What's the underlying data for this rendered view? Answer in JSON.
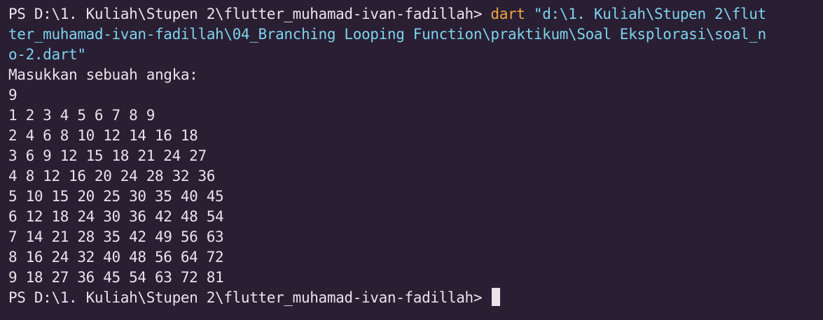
{
  "terminal": {
    "colors": {
      "background": "#2a1e33",
      "foreground": "#e7e4ec",
      "command": "#f0a63e",
      "string": "#7dd3ec",
      "cursor": "#e7e4ec"
    },
    "prompt": "PS D:\\1. Kuliah\\Stupen 2\\flutter_muhamad-ivan-fadillah> ",
    "command": "dart",
    "arg_line1": " \"d:\\1. Kuliah\\Stupen 2\\flut",
    "arg_line2": "ter_muhamad-ivan-fadillah\\04_Branching Looping Function\\praktikum\\Soal Eksplorasi\\soal_n",
    "arg_line3": "o-2.dart\"",
    "input_prompt": "Masukkan sebuah angka:",
    "input_value": "9",
    "output_rows": [
      "1 2 3 4 5 6 7 8 9",
      "2 4 6 8 10 12 14 16 18",
      "3 6 9 12 15 18 21 24 27",
      "4 8 12 16 20 24 28 32 36",
      "5 10 15 20 25 30 35 40 45",
      "6 12 18 24 30 36 42 48 54",
      "7 14 21 28 35 42 49 56 63",
      "8 16 24 32 40 48 56 64 72",
      "9 18 27 36 45 54 63 72 81"
    ],
    "final_prompt": "PS D:\\1. Kuliah\\Stupen 2\\flutter_muhamad-ivan-fadillah> "
  }
}
